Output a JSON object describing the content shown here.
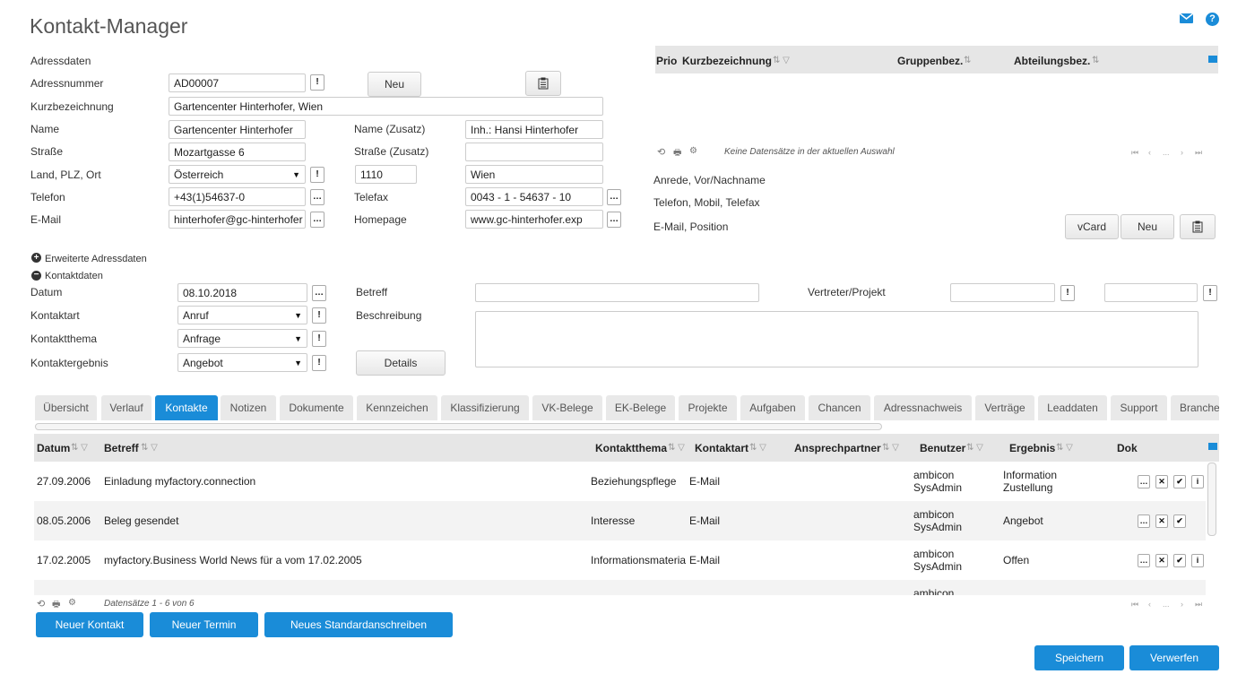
{
  "app": {
    "title": "Kontakt-Manager"
  },
  "address": {
    "section_label": "Adressdaten",
    "labels": {
      "nummer": "Adressnummer",
      "kurz": "Kurzbezeichnung",
      "name": "Name",
      "strasse": "Straße",
      "land": "Land, PLZ, Ort",
      "telefon": "Telefon",
      "email": "E-Mail",
      "name_zusatz": "Name (Zusatz)",
      "strasse_zusatz": "Straße (Zusatz)",
      "telefax": "Telefax",
      "homepage": "Homepage"
    },
    "values": {
      "nummer": "AD00007",
      "kurz": "Gartencenter Hinterhofer, Wien",
      "name": "Gartencenter Hinterhofer",
      "strasse": "Mozartgasse 6",
      "land": "Österreich",
      "plz": "1110",
      "ort": "Wien",
      "telefon": "+43(1)54637-0",
      "email": "hinterhofer@gc-hinterhofer",
      "name_zusatz": "Inh.: Hansi Hinterhofer",
      "strasse_zusatz": "",
      "telefax": "0043 - 1 - 54637 - 10",
      "homepage": "www.gc-hinterhofer.exp"
    },
    "new_button": "Neu"
  },
  "contacts_panel": {
    "columns": [
      "Prio",
      "Kurzbezeichnung",
      "Gruppenbez.",
      "Abteilungsbez."
    ],
    "empty_text": "Keine Datensätze in der aktuellen Auswahl",
    "pager_dots": "...",
    "info_lines": [
      "Anrede, Vor/Nachname",
      "Telefon, Mobil, Telefax",
      "E-Mail, Position"
    ],
    "vcard_button": "vCard",
    "new_button": "Neu"
  },
  "sections": {
    "extended": "Erweiterte Adressdaten",
    "contact": "Kontaktdaten"
  },
  "contact": {
    "labels": {
      "datum": "Datum",
      "art": "Kontaktart",
      "thema": "Kontaktthema",
      "ergebnis": "Kontaktergebnis",
      "betreff": "Betreff",
      "beschreibung": "Beschreibung",
      "vertreter": "Vertreter/Projekt"
    },
    "values": {
      "datum": "08.10.2018",
      "art": "Anruf",
      "thema": "Anfrage",
      "ergebnis": "Angebot",
      "betreff": "",
      "beschreibung": ""
    },
    "details_button": "Details"
  },
  "tabs": [
    "Übersicht",
    "Verlauf",
    "Kontakte",
    "Notizen",
    "Dokumente",
    "Kennzeichen",
    "Klassifizierung",
    "VK-Belege",
    "EK-Belege",
    "Projekte",
    "Aufgaben",
    "Chancen",
    "Adressnachweis",
    "Verträge",
    "Leaddaten",
    "Support",
    "Branche"
  ],
  "active_tab": "Kontakte",
  "table": {
    "columns": [
      "Datum",
      "Betreff",
      "Kontaktthema",
      "Kontaktart",
      "Ansprechpartner",
      "Benutzer",
      "Ergebnis",
      "Dok"
    ],
    "rows": [
      {
        "datum": "27.09.2006",
        "betreff": "Einladung myfactory.connection",
        "thema": "Beziehungspflege",
        "art": "E-Mail",
        "ansprech": "",
        "benutzer1": "ambicon",
        "benutzer2": "SysAdmin",
        "ergebnis1": "Information",
        "ergebnis2": "Zustellung"
      },
      {
        "datum": "08.05.2006",
        "betreff": "Beleg gesendet",
        "thema": "Interesse",
        "art": "E-Mail",
        "ansprech": "",
        "benutzer1": "ambicon",
        "benutzer2": "SysAdmin",
        "ergebnis1": "Angebot",
        "ergebnis2": ""
      },
      {
        "datum": "17.02.2005",
        "betreff": "myfactory.Business World News für a vom 17.02.2005",
        "thema": "Informationsmateria",
        "art": "E-Mail",
        "ansprech": "",
        "benutzer1": "ambicon",
        "benutzer2": "SysAdmin",
        "ergebnis1": "Offen",
        "ergebnis2": ""
      },
      {
        "datum": "",
        "betreff": "",
        "thema": "",
        "art": "",
        "ansprech": "",
        "benutzer1": "ambicon",
        "benutzer2": "",
        "ergebnis1": "",
        "ergebnis2": ""
      }
    ],
    "footer": "Datensätze 1 - 6 von 6",
    "pager_dots": "..."
  },
  "actions": {
    "neuer_kontakt": "Neuer Kontakt",
    "neuer_termin": "Neuer Termin",
    "neues_standard": "Neues Standardanschreiben",
    "speichern": "Speichern",
    "verwerfen": "Verwerfen"
  },
  "colors": {
    "accent": "#1a8cd8",
    "header_bg": "#e6e6e6",
    "row_alt": "#f3f3f3"
  },
  "icons": [
    "mail-icon",
    "help-icon",
    "refresh-icon",
    "print-icon",
    "settings-icon",
    "clipboard-icon",
    "plus-circle-icon",
    "minus-circle-icon"
  ]
}
